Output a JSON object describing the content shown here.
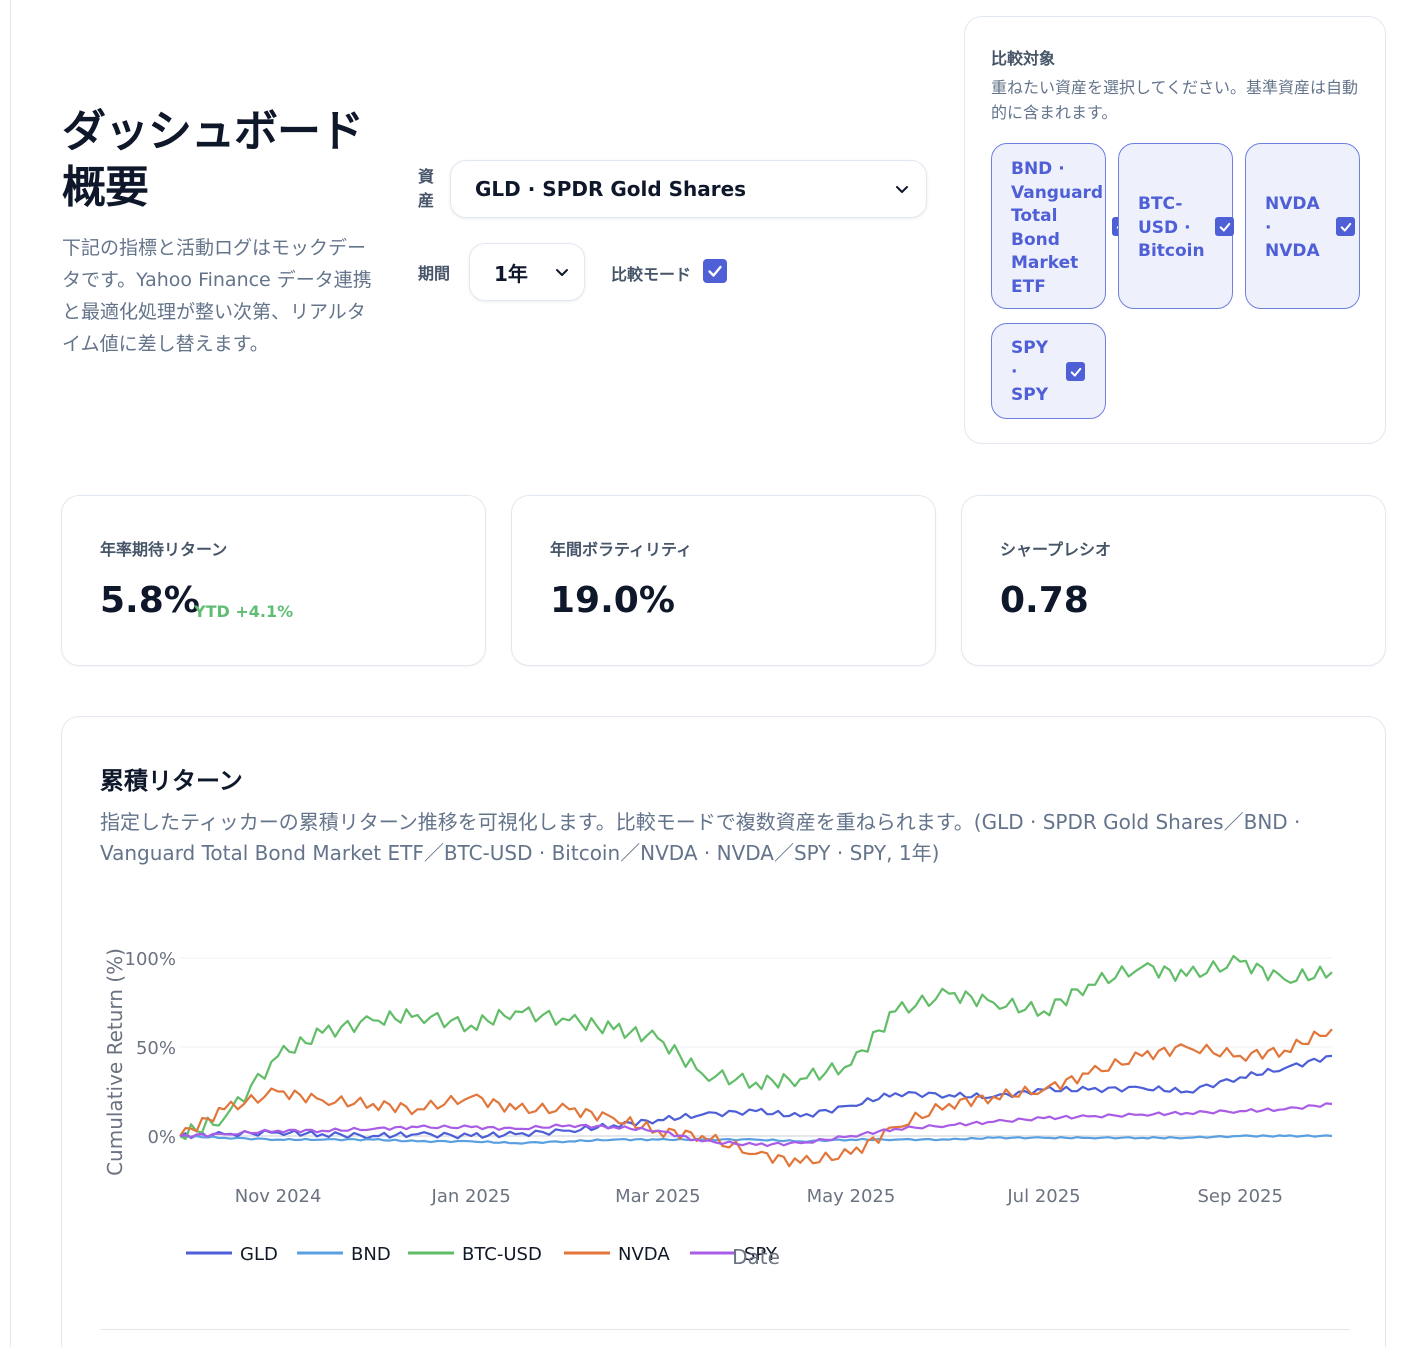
{
  "hero": {
    "title": "ダッシュボード概要",
    "description": "下記の指標と活動ログはモックデータです。Yahoo Finance データ連携と最適化処理が整い次第、リアルタイム値に差し替えます。"
  },
  "controls": {
    "asset_label": "資産",
    "asset_value": "GLD · SPDR Gold Shares",
    "period_label": "期間",
    "period_value": "1年",
    "compare_label": "比較モード",
    "compare_checked": true
  },
  "compare_panel": {
    "title": "比較対象",
    "description": "重ねたい資産を選択してください。基準資産は自動的に含まれます。",
    "chips": [
      {
        "label": "BND · Vanguard Total Bond Market ETF",
        "checked": true
      },
      {
        "label": "BTC-USD · Bitcoin",
        "checked": true
      },
      {
        "label": "NVDA · NVDA",
        "checked": true
      },
      {
        "label": "SPY · SPY",
        "checked": true
      }
    ]
  },
  "kpis": [
    {
      "label": "年率期待リターン",
      "value": "5.8%",
      "change": "YTD +4.1%"
    },
    {
      "label": "年間ボラティリティ",
      "value": "19.0%"
    },
    {
      "label": "シャープレシオ",
      "value": "0.78"
    }
  ],
  "colors": {
    "accent": "#4f5fd6",
    "positive": "#5fbd74",
    "GLD": "#4c5fd7",
    "BND": "#5aa0e0",
    "BTC-USD": "#62bd69",
    "NVDA": "#e2763a",
    "SPY": "#a95de6"
  },
  "chart_card": {
    "title": "累積リターン",
    "description": "指定したティッカーの累積リターン推移を可視化します。比較モードで複数資産を重ねられます。(GLD · SPDR Gold Shares／BND · Vanguard Total Bond Market ETF／BTC-USD · Bitcoin／NVDA · NVDA／SPY · SPY, 1年)"
  },
  "chart_data": {
    "type": "line",
    "xlabel": "Date",
    "ylabel": "Cumulative Return (%)",
    "x_range": [
      "2024-10-01",
      "2025-09-30"
    ],
    "x_ticks": [
      "Nov 2024",
      "Jan 2025",
      "Mar 2025",
      "May 2025",
      "Jul 2025",
      "Sep 2025"
    ],
    "y_ticks": [
      "0%",
      "50%",
      "100%"
    ],
    "ylim": [
      -30,
      110
    ],
    "grid": true,
    "legend_position": "bottom",
    "x": [
      "2024-10-01",
      "2024-10-15",
      "2024-11-01",
      "2024-11-15",
      "2024-12-01",
      "2024-12-15",
      "2025-01-01",
      "2025-01-15",
      "2025-02-01",
      "2025-02-15",
      "2025-03-01",
      "2025-03-15",
      "2025-04-01",
      "2025-04-15",
      "2025-05-01",
      "2025-05-15",
      "2025-06-01",
      "2025-06-15",
      "2025-07-01",
      "2025-07-15",
      "2025-08-01",
      "2025-08-15",
      "2025-09-01",
      "2025-09-15",
      "2025-09-30"
    ],
    "series": [
      {
        "name": "GLD",
        "values": [
          0,
          1,
          2,
          1,
          0,
          1,
          0,
          1,
          3,
          6,
          9,
          12,
          14,
          11,
          17,
          24,
          23,
          22,
          26,
          26,
          27,
          25,
          33,
          38,
          45
        ]
      },
      {
        "name": "BND",
        "values": [
          0,
          -1,
          -2,
          -2,
          -2,
          -3,
          -3,
          -4,
          -3,
          -2,
          -2,
          -2,
          -2,
          -3,
          -2,
          -2,
          -2,
          -1,
          -1,
          -1,
          -1,
          -1,
          0,
          0,
          0
        ]
      },
      {
        "name": "BTC-USD",
        "values": [
          0,
          10,
          45,
          58,
          65,
          68,
          62,
          70,
          65,
          60,
          55,
          35,
          30,
          32,
          40,
          70,
          80,
          75,
          70,
          85,
          95,
          90,
          98,
          88,
          92
        ]
      },
      {
        "name": "NVDA",
        "values": [
          0,
          15,
          25,
          20,
          18,
          15,
          22,
          15,
          15,
          10,
          3,
          0,
          -10,
          -15,
          -10,
          5,
          18,
          22,
          26,
          35,
          45,
          50,
          45,
          48,
          60
        ]
      },
      {
        "name": "SPY",
        "values": [
          0,
          1,
          3,
          3,
          4,
          5,
          5,
          4,
          6,
          5,
          3,
          -3,
          -5,
          -4,
          0,
          4,
          6,
          8,
          10,
          11,
          12,
          13,
          14,
          15,
          18
        ]
      }
    ]
  }
}
